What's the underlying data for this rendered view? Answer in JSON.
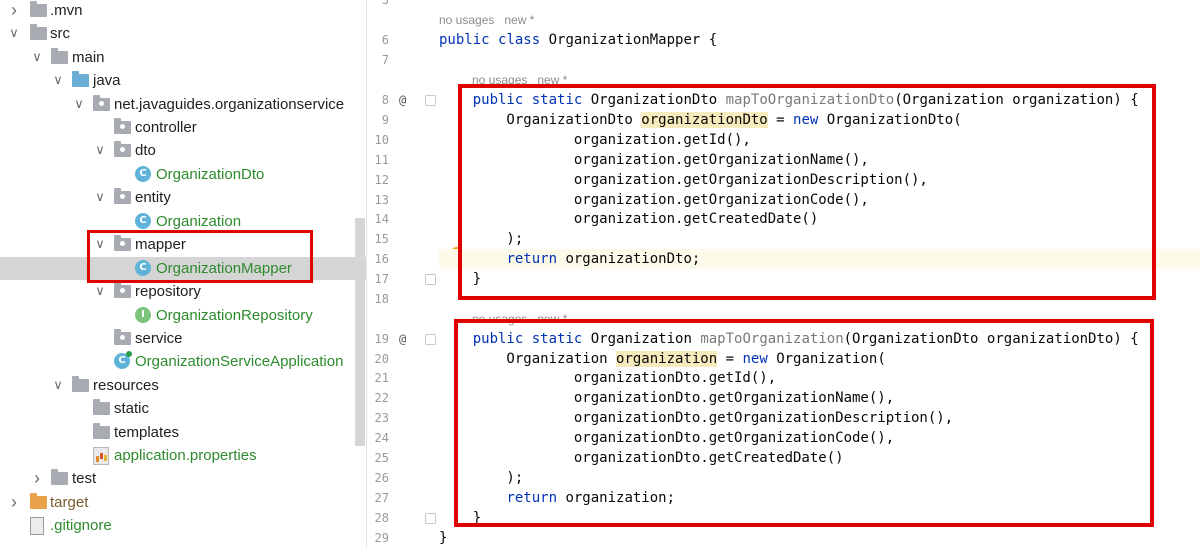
{
  "project_tree": {
    "items": [
      {
        "label": ".mvn",
        "icon": "folder-icon",
        "expanded": false
      },
      {
        "label": "src",
        "icon": "folder-icon",
        "expanded": true
      },
      {
        "label": "main",
        "icon": "folder-icon",
        "expanded": true
      },
      {
        "label": "java",
        "icon": "source-folder-icon",
        "expanded": true
      },
      {
        "label": "net.javaguides.organizationservice",
        "icon": "package-icon",
        "expanded": true
      },
      {
        "label": "controller",
        "icon": "package-icon"
      },
      {
        "label": "dto",
        "icon": "package-icon",
        "expanded": true
      },
      {
        "label": "OrganizationDto",
        "icon": "class-icon",
        "icon_letter": "C"
      },
      {
        "label": "entity",
        "icon": "package-icon",
        "expanded": true
      },
      {
        "label": "Organization",
        "icon": "class-icon",
        "icon_letter": "C"
      },
      {
        "label": "mapper",
        "icon": "package-icon",
        "expanded": true
      },
      {
        "label": "OrganizationMapper",
        "icon": "class-icon",
        "icon_letter": "C",
        "selected": true
      },
      {
        "label": "repository",
        "icon": "package-icon",
        "expanded": true
      },
      {
        "label": "OrganizationRepository",
        "icon": "interface-icon",
        "icon_letter": "I"
      },
      {
        "label": "service",
        "icon": "package-icon"
      },
      {
        "label": "OrganizationServiceApplication",
        "icon": "spring-app-class-icon",
        "icon_letter": "C"
      },
      {
        "label": "resources",
        "icon": "resources-folder-icon",
        "expanded": true
      },
      {
        "label": "static",
        "icon": "folder-icon"
      },
      {
        "label": "templates",
        "icon": "folder-icon"
      },
      {
        "label": "application.properties",
        "icon": "properties-file-icon"
      },
      {
        "label": "test",
        "icon": "folder-icon",
        "expanded": false
      },
      {
        "label": "target",
        "icon": "excluded-folder-icon",
        "expanded": false
      },
      {
        "label": ".gitignore",
        "icon": "file-icon"
      }
    ]
  },
  "editor": {
    "hints": {
      "class_usage": "no usages   new *",
      "method1_usage": "no usages   new *",
      "method2_usage": "no usages   new *"
    },
    "gutter_marks": {
      "override_symbol": "@"
    },
    "lines": [
      {
        "no": "5",
        "text": ""
      },
      {
        "no": "6",
        "text": "public class OrganizationMapper {"
      },
      {
        "no": "7",
        "text": ""
      },
      {
        "no": "8",
        "text": "    public static OrganizationDto mapToOrganizationDto(Organization organization) {"
      },
      {
        "no": "9",
        "text": "        OrganizationDto organizationDto = new OrganizationDto("
      },
      {
        "no": "10",
        "text": "                organization.getId(),"
      },
      {
        "no": "11",
        "text": "                organization.getOrganizationName(),"
      },
      {
        "no": "12",
        "text": "                organization.getOrganizationDescription(),"
      },
      {
        "no": "13",
        "text": "                organization.getOrganizationCode(),"
      },
      {
        "no": "14",
        "text": "                organization.getCreatedDate()"
      },
      {
        "no": "15",
        "text": "        );"
      },
      {
        "no": "16",
        "text": "        return organizationDto;"
      },
      {
        "no": "17",
        "text": "    }"
      },
      {
        "no": "18",
        "text": ""
      },
      {
        "no": "19",
        "text": "    public static Organization mapToOrganization(OrganizationDto organizationDto) {"
      },
      {
        "no": "20",
        "text": "        Organization organization = new Organization("
      },
      {
        "no": "21",
        "text": "                organizationDto.getId(),"
      },
      {
        "no": "22",
        "text": "                organizationDto.getOrganizationName(),"
      },
      {
        "no": "23",
        "text": "                organizationDto.getOrganizationDescription(),"
      },
      {
        "no": "24",
        "text": "                organizationDto.getOrganizationCode(),"
      },
      {
        "no": "25",
        "text": "                organizationDto.getCreatedDate()"
      },
      {
        "no": "26",
        "text": "        );"
      },
      {
        "no": "27",
        "text": "        return organization;"
      },
      {
        "no": "28",
        "text": "    }"
      },
      {
        "no": "29",
        "text": "}"
      }
    ]
  },
  "colors": {
    "keyword": "#0033b3",
    "method_declaration": "#7a7a7a",
    "class_name_in_tree": "#2e8b2e",
    "annotation_box": "#e10000",
    "variable_highlight": "#f6ebbc",
    "selected_row": "#d5d5d5"
  }
}
